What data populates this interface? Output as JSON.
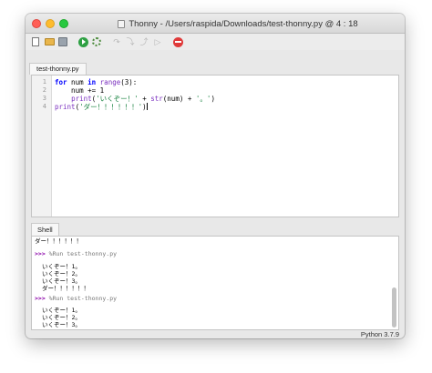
{
  "window": {
    "title": "Thonny  -  /Users/raspida/Downloads/test-thonny.py  @  4 : 18"
  },
  "toolbar": {
    "icons": [
      "new-file-icon",
      "open-file-icon",
      "save-file-icon",
      "run-icon",
      "debug-icon",
      "step-over-icon",
      "step-into-icon",
      "step-out-icon",
      "resume-icon",
      "stop-icon"
    ]
  },
  "editor": {
    "tab_label": "test-thonny.py",
    "line_numbers": [
      "1",
      "2",
      "3",
      "4"
    ]
  },
  "shell": {
    "tab_label": "Shell",
    "prompt": ">>>",
    "top_partial": "ダー！！！！！！",
    "run_command": "%Run test-thonny.py",
    "output_1": "いくぞー！1。",
    "output_2": "いくぞー！2。",
    "output_3": "いくぞー！3。",
    "output_final": "ダー！！！！！！"
  },
  "status": {
    "interpreter": "Python 3.7.9"
  }
}
